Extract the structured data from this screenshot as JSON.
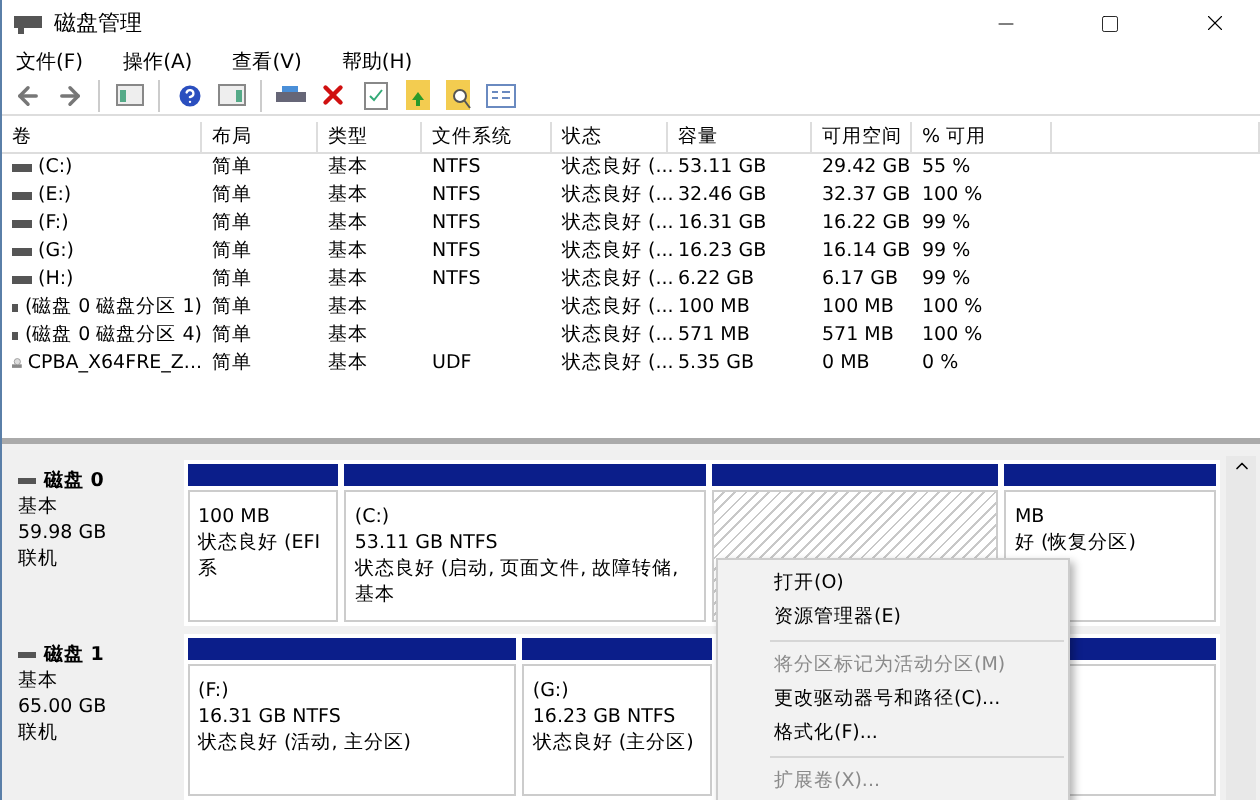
{
  "window": {
    "title": "磁盘管理"
  },
  "menu": [
    "文件(F)",
    "操作(A)",
    "查看(V)",
    "帮助(H)"
  ],
  "table": {
    "columns": [
      "卷",
      "布局",
      "类型",
      "文件系统",
      "状态",
      "容量",
      "可用空间",
      "% 可用",
      ""
    ],
    "rows": [
      {
        "kind": "disk",
        "cells": [
          "(C:)",
          "简单",
          "基本",
          "NTFS",
          "状态良好 (...",
          "53.11 GB",
          "29.42 GB",
          "55 %"
        ]
      },
      {
        "kind": "disk",
        "cells": [
          "(E:)",
          "简单",
          "基本",
          "NTFS",
          "状态良好 (...",
          "32.46 GB",
          "32.37 GB",
          "100 %"
        ]
      },
      {
        "kind": "disk",
        "cells": [
          "(F:)",
          "简单",
          "基本",
          "NTFS",
          "状态良好 (...",
          "16.31 GB",
          "16.22 GB",
          "99 %"
        ]
      },
      {
        "kind": "disk",
        "cells": [
          "(G:)",
          "简单",
          "基本",
          "NTFS",
          "状态良好 (...",
          "16.23 GB",
          "16.14 GB",
          "99 %"
        ]
      },
      {
        "kind": "disk",
        "cells": [
          "(H:)",
          "简单",
          "基本",
          "NTFS",
          "状态良好 (...",
          "6.22 GB",
          "6.17 GB",
          "99 %"
        ]
      },
      {
        "kind": "disk",
        "cells": [
          "(磁盘 0 磁盘分区 1)",
          "简单",
          "基本",
          "",
          "状态良好 (...",
          "100 MB",
          "100 MB",
          "100 %"
        ]
      },
      {
        "kind": "disk",
        "cells": [
          "(磁盘 0 磁盘分区 4)",
          "简单",
          "基本",
          "",
          "状态良好 (...",
          "571 MB",
          "571 MB",
          "100 %"
        ]
      },
      {
        "kind": "cdrom",
        "cells": [
          "CPBA_X64FRE_Z...",
          "简单",
          "基本",
          "UDF",
          "状态良好 (...",
          "5.35 GB",
          "0 MB",
          "0 %"
        ]
      }
    ]
  },
  "disks": [
    {
      "name": "磁盘 0",
      "type": "基本",
      "size": "59.98 GB",
      "state": "联机",
      "partitions": [
        {
          "lines": [
            "100 MB",
            "状态良好 (EFI 系"
          ],
          "selected": false
        },
        {
          "lines": [
            "(C:)",
            "53.11 GB NTFS",
            "状态良好 (启动, 页面文件, 故障转储, 基本"
          ],
          "selected": false
        },
        {
          "selected": true
        },
        {
          "lines": [
            "MB",
            "好 (恢复分区)"
          ],
          "selected": false
        }
      ]
    },
    {
      "name": "磁盘 1",
      "type": "基本",
      "size": "65.00 GB",
      "state": "联机",
      "partitions": [
        {
          "lines": [
            "(F:)",
            "16.31 GB NTFS",
            "状态良好 (活动, 主分区)"
          ],
          "selected": false
        },
        {
          "lines": [
            "(G:)",
            "16.23 GB NTFS",
            "状态良好 (主分区)"
          ],
          "selected": false
        },
        {
          "selected": false
        }
      ]
    }
  ],
  "context_menu": [
    {
      "kind": "item",
      "label": "打开(O)",
      "disabled": false
    },
    {
      "kind": "item",
      "label": "资源管理器(E)",
      "disabled": false
    },
    {
      "kind": "separator"
    },
    {
      "kind": "item",
      "label": "将分区标记为活动分区(M)",
      "disabled": true
    },
    {
      "kind": "item",
      "label": "更改驱动器号和路径(C)...",
      "disabled": false
    },
    {
      "kind": "item",
      "label": "格式化(F)...",
      "disabled": false
    },
    {
      "kind": "separator"
    },
    {
      "kind": "item",
      "label": "扩展卷(X)...",
      "disabled": true
    }
  ]
}
